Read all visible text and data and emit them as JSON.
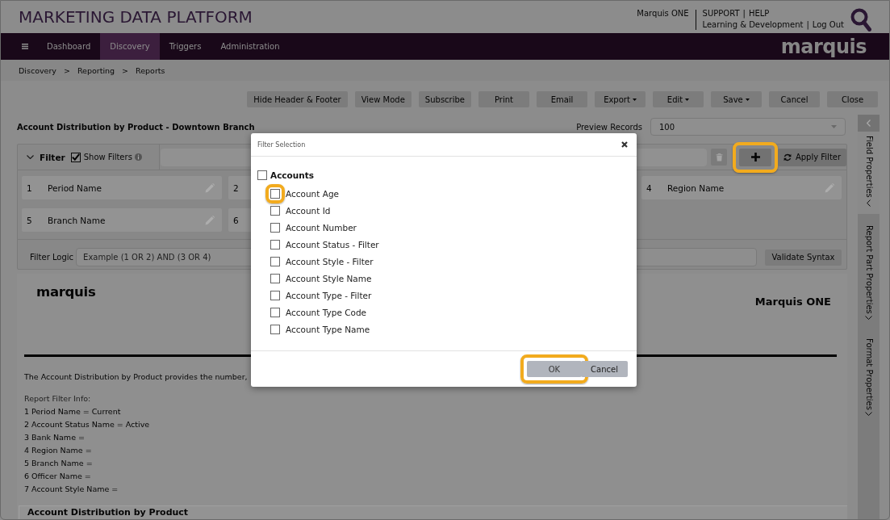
{
  "header": {
    "title": "MARKETING DATA PLATFORM",
    "account": "Marquis ONE",
    "separator": "|",
    "link_rows": [
      {
        "links": [
          "SUPPORT",
          "HELP"
        ]
      },
      {
        "links": [
          "Learning & Development",
          "Log Out"
        ]
      }
    ]
  },
  "nav": {
    "tabs": [
      {
        "label": "Dashboard",
        "selected": false
      },
      {
        "label": "Discovery",
        "selected": true
      },
      {
        "label": "Triggers",
        "selected": false
      },
      {
        "label": "Administration",
        "selected": false
      }
    ],
    "logo": "marquis"
  },
  "breadcrumb": {
    "items": [
      "Discovery",
      "Reporting",
      "Reports"
    ],
    "separator": ">"
  },
  "toolbar": {
    "buttons": [
      {
        "label": "Hide Header & Footer",
        "dropdown": false
      },
      {
        "label": "View Mode",
        "dropdown": false
      },
      {
        "label": "Subscribe",
        "dropdown": false
      },
      {
        "label": "Print",
        "dropdown": false
      },
      {
        "label": "Email",
        "dropdown": false
      },
      {
        "label": "Export",
        "dropdown": true
      },
      {
        "label": "Edit",
        "dropdown": true
      },
      {
        "label": "Save",
        "dropdown": true
      },
      {
        "label": "Cancel",
        "dropdown": false
      },
      {
        "label": "Close",
        "dropdown": false
      }
    ]
  },
  "report": {
    "title": "Account Distribution by Product - Downtown Branch",
    "preview_label": "Preview Records",
    "preview_value": "100"
  },
  "filter_panel": {
    "title": "Filter",
    "expanded": true,
    "show_filters": {
      "label": "Show Filters",
      "checked": true
    },
    "actions": [
      {
        "kind": "delete",
        "highlighted": false
      },
      {
        "kind": "add",
        "highlighted": true
      },
      {
        "kind": "apply",
        "label": "Apply Filter",
        "highlighted": false
      }
    ],
    "filters": [
      {
        "number": "1",
        "name": "Period Name"
      },
      {
        "number": "2"
      },
      {
        "number": "4",
        "name": "Region Name"
      },
      {
        "number": "5",
        "name": "Branch Name"
      },
      {
        "number": "6"
      }
    ],
    "logic_label": "Filter Logic",
    "logic_placeholder": "Example (1 OR 2) AND (3 OR 4)",
    "validate_label": "Validate Syntax"
  },
  "preview": {
    "logo": "marquis",
    "company": "Marquis ONE",
    "description": "The Account Distribution by Product provides the number,",
    "filter_info_title": "Report Filter Info:",
    "filter_info": [
      "1 Period Name = Current",
      "2 Account Status Name = Active",
      "3 Bank Name =",
      "4 Region Name =",
      "5 Branch Name =",
      "6 Officer Name =",
      "7 Account Style Name ="
    ],
    "section_title": "Account Distribution by Product"
  },
  "sidebar": {
    "tabs": [
      {
        "label": "Field Properties",
        "selected": true,
        "expanded": true
      },
      {
        "label": "Report Part Properties",
        "selected": false,
        "expanded": false
      },
      {
        "label": "Format Properties",
        "selected": false,
        "expanded": false
      }
    ]
  },
  "dialog": {
    "title": "Filter Selection",
    "tree": [
      {
        "label": "Accounts",
        "checked": false,
        "highlighted": false,
        "children": [
          {
            "label": "Account Age",
            "checked": false,
            "highlighted": true
          },
          {
            "label": "Account Id",
            "checked": false,
            "highlighted": false
          },
          {
            "label": "Account Number",
            "checked": false,
            "highlighted": false
          },
          {
            "label": "Account Status - Filter",
            "checked": false,
            "highlighted": false
          },
          {
            "label": "Account Style - Filter",
            "checked": false,
            "highlighted": false
          },
          {
            "label": "Account Style Name",
            "checked": false,
            "highlighted": false
          },
          {
            "label": "Account Type - Filter",
            "checked": false,
            "highlighted": false
          },
          {
            "label": "Account Type Code",
            "checked": false,
            "highlighted": false
          },
          {
            "label": "Account Type Name",
            "checked": false,
            "highlighted": false
          }
        ]
      }
    ],
    "buttons": [
      {
        "label": "OK",
        "kind": "primary",
        "highlighted": true
      },
      {
        "label": "Cancel",
        "kind": "secondary",
        "highlighted": false
      }
    ]
  }
}
